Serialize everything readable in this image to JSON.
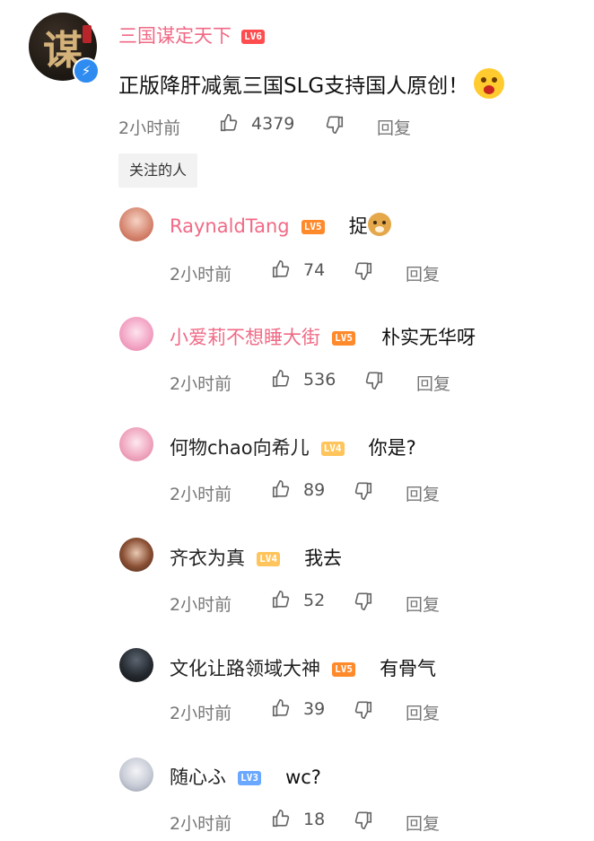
{
  "main_comment": {
    "username": "三国谋定天下",
    "level": "LV6",
    "avatar_char": "谋",
    "text": "正版降肝减氪三国SLG支持国人原创！",
    "time": "2小时前",
    "likes": "4379",
    "reply_label": "回复"
  },
  "follow_tag": "关注的人",
  "replies": [
    {
      "username": "RaynaldTang",
      "level": "LV5",
      "text": "捉",
      "time": "2小时前",
      "likes": "74",
      "reply_label": "回复"
    },
    {
      "username": "小爱莉不想睡大街",
      "level": "LV5",
      "text": "朴实无华呀",
      "time": "2小时前",
      "likes": "536",
      "reply_label": "回复"
    },
    {
      "username": "何物chao向希儿",
      "level": "LV4",
      "text": "你是?",
      "time": "2小时前",
      "likes": "89",
      "reply_label": "回复"
    },
    {
      "username": "齐衣为真",
      "level": "LV4",
      "text": "我去",
      "time": "2小时前",
      "likes": "52",
      "reply_label": "回复"
    },
    {
      "username": "文化让路领域大神",
      "level": "LV5",
      "text": "有骨气",
      "time": "2小时前",
      "likes": "39",
      "reply_label": "回复"
    },
    {
      "username": "随心ふ",
      "level": "LV3",
      "text": "wc?",
      "time": "2小时前",
      "likes": "18",
      "reply_label": "回复"
    }
  ],
  "colors": {
    "username_pink": "#f06a86",
    "meta_gray": "#777777",
    "verified_blue": "#2e8bf0",
    "lv6": "#ff4d4f",
    "lv5": "#ff8a2b",
    "lv4": "#ffc45b",
    "lv3": "#6aa8ff"
  }
}
